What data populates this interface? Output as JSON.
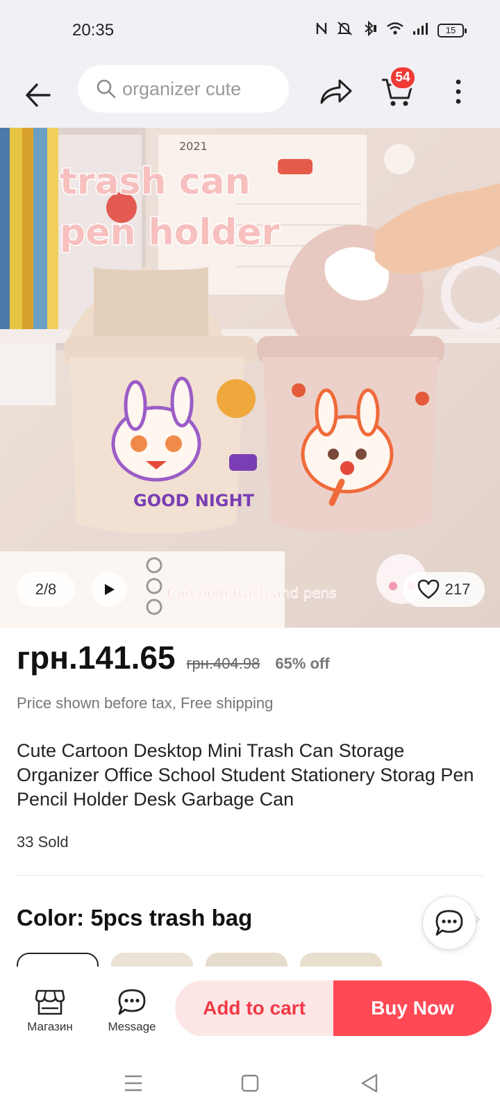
{
  "status_bar": {
    "time": "20:35",
    "battery": "15",
    "icons": [
      "nfc-icon",
      "mute-icon",
      "bluetooth-icon",
      "wifi-icon",
      "signal-icon",
      "battery-icon"
    ]
  },
  "search": {
    "placeholder": "organizer cute"
  },
  "cart": {
    "badge_count": "54"
  },
  "gallery": {
    "counter": "2/8",
    "likes": "217",
    "overlay_title_line1": "trash can",
    "overlay_title_line2": "pen holder",
    "overlay_caption": "Can hold trash and pens",
    "can_text": "GOOD NIGHT",
    "calendar_year": "2021"
  },
  "product": {
    "price": "грн.141.65",
    "original_price": "грн.404.98",
    "discount": "65% off",
    "tax_note": "Price shown before tax, Free shipping",
    "title": "Cute Cartoon Desktop Mini Trash Can Storage Organizer Office School Student Stationery Storag Pen Pencil Holder Desk Garbage Can",
    "sold": "33 Sold",
    "color_label": "Color: 5pcs trash bag"
  },
  "bottom_bar": {
    "store_label": "Магазин",
    "message_label": "Message",
    "add_to_cart": "Add to cart",
    "buy_now": "Buy Now"
  },
  "colors": {
    "accent": "#ff4a55",
    "accent_light": "#fde6e6",
    "badge": "#f03a35"
  }
}
